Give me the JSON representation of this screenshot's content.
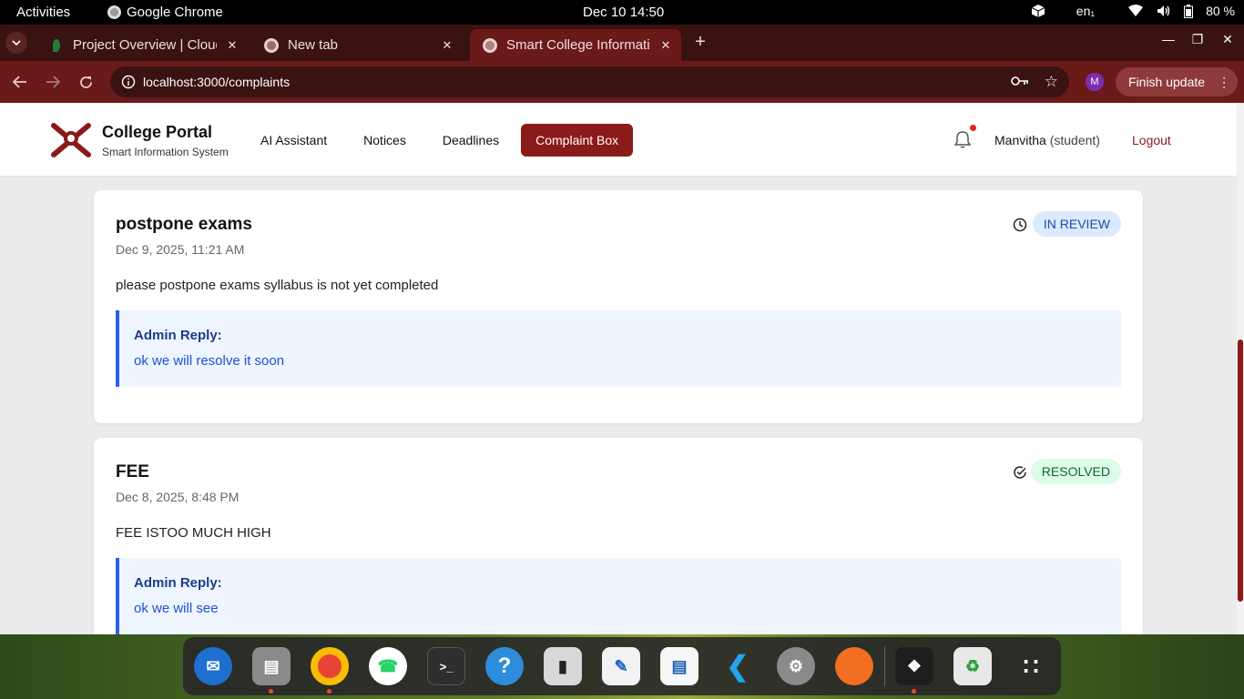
{
  "system_bar": {
    "activities": "Activities",
    "app_name": "Google Chrome",
    "clock": "Dec 10  14:50",
    "keyboard": "en₁",
    "battery": "80 %"
  },
  "browser": {
    "tabs": [
      {
        "title": "Project Overview | Cloud",
        "close": "✕"
      },
      {
        "title": "New tab",
        "close": "✕"
      },
      {
        "title": "Smart College Information",
        "close": "✕"
      }
    ],
    "new_tab": "+",
    "url": "localhost:3000/complaints",
    "profile_initial": "M",
    "finish_update": "Finish update"
  },
  "header": {
    "brand_title": "College Portal",
    "brand_subtitle": "Smart Information System",
    "nav": [
      "AI Assistant",
      "Notices",
      "Deadlines",
      "Complaint Box"
    ],
    "user_name": "Manvitha",
    "user_role": "(student)",
    "logout": "Logout"
  },
  "complaints": [
    {
      "title": "postpone exams",
      "date": "Dec 9, 2025, 11:21 AM",
      "status": "IN REVIEW",
      "body": "please postpone exams syllabus is not yet completed",
      "reply_label": "Admin Reply:",
      "reply_text": "ok we will resolve it soon"
    },
    {
      "title": "FEE",
      "date": "Dec 8, 2025, 8:48 PM",
      "status": "RESOLVED",
      "body": "FEE ISTOO MUCH HIGH",
      "reply_label": "Admin Reply:",
      "reply_text": "ok we will see"
    }
  ],
  "colors": {
    "brand": "#8b1a1a",
    "in_review_bg": "#dbeafe",
    "resolved_bg": "#dcfce7",
    "reply_border": "#2563eb"
  },
  "dock": [
    "thunderbird-icon",
    "files-icon",
    "chrome-icon",
    "whatsapp-icon",
    "terminal-icon",
    "help-icon",
    "app-center-icon",
    "text-editor-icon",
    "writer-icon",
    "vscode-icon",
    "settings-icon",
    "firefox-icon",
    "box-icon",
    "trash-icon",
    "app-grid-icon"
  ]
}
